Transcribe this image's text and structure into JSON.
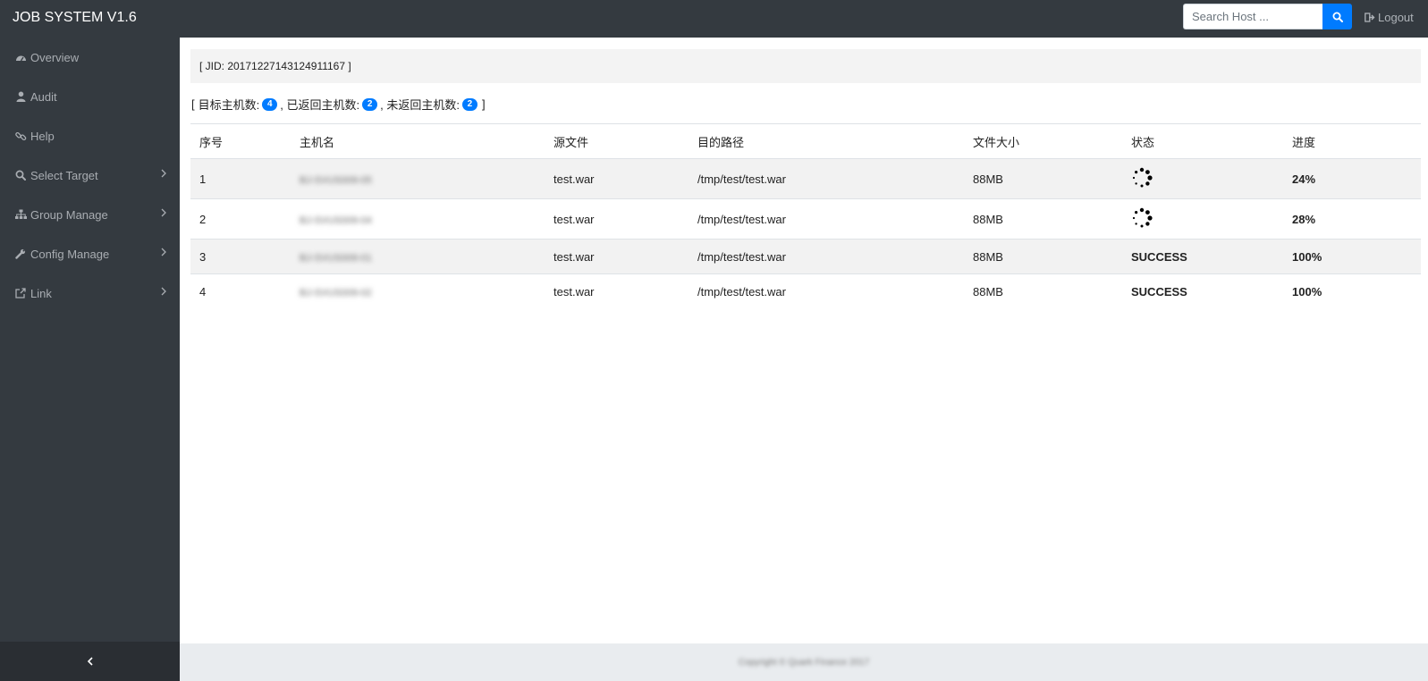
{
  "app": {
    "title": "JOB SYSTEM V1.6"
  },
  "header": {
    "search": {
      "placeholder": "Search Host ...",
      "value": ""
    },
    "logout_label": "Logout"
  },
  "sidebar": {
    "items": [
      {
        "label": "Overview",
        "icon": "dashboard-icon",
        "has_submenu": false
      },
      {
        "label": "Audit",
        "icon": "user-icon",
        "has_submenu": false
      },
      {
        "label": "Help",
        "icon": "link-icon",
        "has_submenu": false
      },
      {
        "label": "Select Target",
        "icon": "search-icon",
        "has_submenu": true
      },
      {
        "label": "Group Manage",
        "icon": "sitemap-icon",
        "has_submenu": true
      },
      {
        "label": "Config Manage",
        "icon": "wrench-icon",
        "has_submenu": true
      },
      {
        "label": "Link",
        "icon": "external-link-icon",
        "has_submenu": true
      }
    ],
    "collapse_icon": "chevron-left-icon"
  },
  "job": {
    "jid_text": "[ JID: 20171227143124911167 ]",
    "counts": {
      "open": "[",
      "target_label": "目标主机数:",
      "target_count": "4",
      "returned_label": ", 已返回主机数:",
      "returned_count": "2",
      "pending_label": ", 未返回主机数:",
      "pending_count": "2",
      "close": "]"
    }
  },
  "table": {
    "columns": [
      "序号",
      "主机名",
      "源文件",
      "目的路径",
      "文件大小",
      "状态",
      "进度"
    ],
    "rows": [
      {
        "no": "1",
        "host": "BJ-SVUS009-05",
        "src": "test.war",
        "dest": "/tmp/test/test.war",
        "size": "88MB",
        "status": "",
        "status_icon": "spinner-icon",
        "progress": "24%"
      },
      {
        "no": "2",
        "host": "BJ-SVUS009-04",
        "src": "test.war",
        "dest": "/tmp/test/test.war",
        "size": "88MB",
        "status": "",
        "status_icon": "spinner-icon",
        "progress": "28%"
      },
      {
        "no": "3",
        "host": "BJ-SVUS009-01",
        "src": "test.war",
        "dest": "/tmp/test/test.war",
        "size": "88MB",
        "status": "SUCCESS",
        "status_icon": "",
        "progress": "100%"
      },
      {
        "no": "4",
        "host": "BJ-SVUS009-02",
        "src": "test.war",
        "dest": "/tmp/test/test.war",
        "size": "88MB",
        "status": "SUCCESS",
        "status_icon": "",
        "progress": "100%"
      }
    ]
  },
  "footer": {
    "text": "Copyright © Quark Finance 2017"
  },
  "colors": {
    "topbar": "#343a40",
    "accent": "#007bff",
    "success": "#1a8a1a"
  }
}
